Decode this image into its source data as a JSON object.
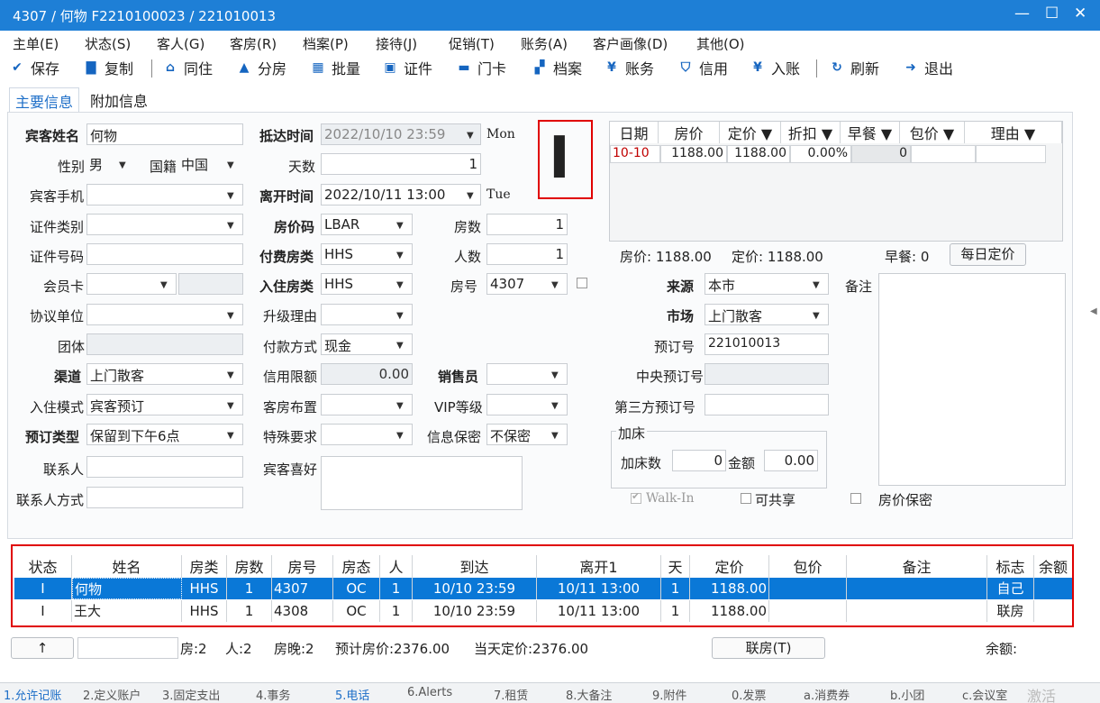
{
  "window": {
    "title": "4307 / 何物 F2210100023 / 221010013",
    "minimize": "—",
    "maximize": "☐",
    "close": "✕"
  },
  "menu": [
    "主单(E)",
    "状态(S)",
    "客人(G)",
    "客房(R)",
    "档案(P)",
    "接待(J)",
    "促销(T)",
    "账务(A)",
    "客户画像(D)",
    "其他(O)"
  ],
  "toolbar": [
    {
      "label": "保存",
      "icon": "check-circle-icon"
    },
    {
      "label": "复制",
      "icon": "copy-icon"
    },
    {
      "label": "同住",
      "icon": "home-icon"
    },
    {
      "label": "分房",
      "icon": "house-icon"
    },
    {
      "label": "批量",
      "icon": "grid-icon"
    },
    {
      "label": "证件",
      "icon": "id-card-icon"
    },
    {
      "label": "门卡",
      "icon": "card-icon"
    },
    {
      "label": "档案",
      "icon": "folder-icon"
    },
    {
      "label": "账务",
      "icon": "bill-icon"
    },
    {
      "label": "信用",
      "icon": "shield-icon"
    },
    {
      "label": "入账",
      "icon": "yen-icon"
    },
    {
      "label": "刷新",
      "icon": "refresh-icon"
    },
    {
      "label": "退出",
      "icon": "exit-icon"
    }
  ],
  "tabs": [
    "主要信息",
    "附加信息"
  ],
  "form": {
    "guest_name_label": "宾客姓名",
    "guest_name": "何物",
    "gender_label": "性别",
    "gender": "男",
    "nationality_label": "国籍",
    "nationality": "中国",
    "phone_label": "宾客手机",
    "phone": "",
    "id_type_label": "证件类别",
    "id_type": "",
    "id_no_label": "证件号码",
    "id_no": "",
    "member_label": "会员卡",
    "member": "",
    "agreement_label": "协议单位",
    "agreement": "",
    "group_label": "团体",
    "group": "",
    "channel_label": "渠道",
    "channel": "上门散客",
    "checkin_mode_label": "入住模式",
    "checkin_mode": "宾客预订",
    "booking_type_label": "预订类型",
    "booking_type": "保留到下午6点",
    "contact_label": "联系人",
    "contact": "",
    "contact_method_label": "联系人方式",
    "contact_method": "",
    "arrival_label": "抵达时间",
    "arrival": "2022/10/10 23:59",
    "arrival_day": "Mon",
    "days_label": "天数",
    "days": "1",
    "depart_label": "离开时间",
    "depart": "2022/10/11 13:00",
    "depart_day": "Tue",
    "rate_code_label": "房价码",
    "rate_code": "LBAR",
    "rooms_label": "房数",
    "rooms": "1",
    "pay_room_type_label": "付费房类",
    "pay_room_type": "HHS",
    "persons_label": "人数",
    "persons": "1",
    "stay_room_type_label": "入住房类",
    "stay_room_type": "HHS",
    "room_no_label": "房号",
    "room_no": "4307",
    "upgrade_label": "升级理由",
    "upgrade": "",
    "pay_method_label": "付款方式",
    "pay_method": "现金",
    "credit_label": "信用限额",
    "credit": "0.00",
    "sales_label": "销售员",
    "sales": "",
    "room_layout_label": "客房布置",
    "room_layout": "",
    "vip_label": "VIP等级",
    "vip": "",
    "special_label": "特殊要求",
    "special": "",
    "privacy_label": "信息保密",
    "privacy": "不保密",
    "preference_label": "宾客喜好",
    "preference": "",
    "source_label": "来源",
    "source": "本市",
    "market_label": "市场",
    "market": "上门散客",
    "booking_no_label": "预订号",
    "booking_no": "221010013",
    "central_no_label": "中央预订号",
    "central_no": "",
    "third_no_label": "第三方预订号",
    "third_no": "",
    "extra_bed_title": "加床",
    "extra_bed_count_label": "加床数",
    "extra_bed_count": "0",
    "extra_bed_amount_label": "金额",
    "extra_bed_amount": "0.00",
    "remark_label": "备注",
    "walkin_label": "Walk-In",
    "shareable_label": "可共享",
    "rate_secret_label": "房价保密",
    "cursor_char": "I"
  },
  "rate_grid": {
    "headers": [
      "日期",
      "房价",
      "定价 ▼",
      "折扣 ▼",
      "早餐 ▼",
      "包价 ▼",
      "理由 ▼"
    ],
    "rows": [
      [
        "10-10",
        "1188.00",
        "1188.00",
        "0.00%",
        "0",
        "",
        ""
      ]
    ],
    "summary_rate": "房价: 1188.00",
    "summary_fixed": "定价: 1188.00",
    "summary_breakfast": "早餐: 0",
    "daily_button": "每日定价"
  },
  "guest_grid": {
    "headers": [
      "状态",
      "姓名",
      "房类",
      "房数",
      "房号",
      "房态",
      "人",
      "到达",
      "离开1",
      "天",
      "定价",
      "包价",
      "备注",
      "标志",
      "余额"
    ],
    "rows": [
      [
        "I",
        "何物",
        "HHS",
        "1",
        "4307",
        "OC",
        "1",
        "10/10 23:59",
        "10/11 13:00",
        "1",
        "1188.00",
        "",
        "",
        "自己",
        ""
      ],
      [
        "I",
        "王大",
        "HHS",
        "1",
        "4308",
        "OC",
        "1",
        "10/10 23:59",
        "10/11 13:00",
        "1",
        "1188.00",
        "",
        "",
        "联房",
        ""
      ]
    ]
  },
  "status": {
    "up_button": "↑",
    "rooms": "房:2",
    "persons": "人:2",
    "nights": "房晚:2",
    "est_rate": "预计房价:2376.00",
    "today_rate": "当天定价:2376.00",
    "link_button": "联房(T)",
    "balance": "余额:"
  },
  "bottom_tabs": [
    "1.允许记账",
    "2.定义账户",
    "3.固定支出",
    "4.事务",
    "5.电话",
    "6.Alerts",
    "7.租赁",
    "8.大备注",
    "9.附件",
    "0.发票",
    "a.消费券",
    "b.小团",
    "c.会议室",
    "激活"
  ]
}
